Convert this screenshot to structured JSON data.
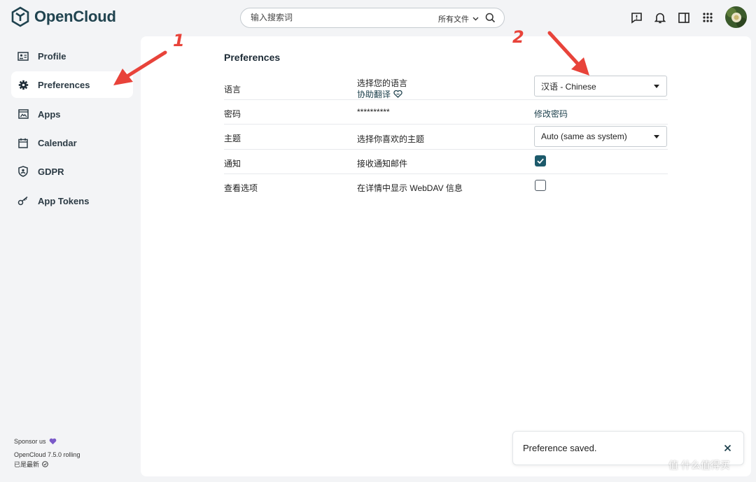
{
  "header": {
    "app_name": "OpenCloud",
    "search": {
      "placeholder": "输入搜索词",
      "scope": "所有文件"
    }
  },
  "sidebar": {
    "items": [
      {
        "label": "Profile",
        "icon": "profile-card-icon",
        "active": false
      },
      {
        "label": "Preferences",
        "icon": "gear-icon",
        "active": true
      },
      {
        "label": "Apps",
        "icon": "apps-window-icon",
        "active": false
      },
      {
        "label": "Calendar",
        "icon": "calendar-icon",
        "active": false
      },
      {
        "label": "GDPR",
        "icon": "shield-user-icon",
        "active": false
      },
      {
        "label": "App Tokens",
        "icon": "key-icon",
        "active": false
      }
    ],
    "sponsor": "Sponsor us",
    "version": "OpenCloud 7.5.0 rolling",
    "update_status": "已是最新"
  },
  "main": {
    "title": "Preferences",
    "rows": [
      {
        "label": "语言",
        "description": "选择您的语言",
        "sub_link": "协助翻译",
        "control": "select",
        "value": "汉语 - Chinese"
      },
      {
        "label": "密码",
        "description": "**********",
        "control": "link",
        "value": "修改密码"
      },
      {
        "label": "主题",
        "description": "选择你喜欢的主题",
        "control": "select",
        "value": "Auto (same as system)"
      },
      {
        "label": "通知",
        "description": "接收通知邮件",
        "control": "checkbox",
        "checked": true
      },
      {
        "label": "查看选项",
        "description": "在详情中显示 WebDAV 信息",
        "control": "checkbox",
        "checked": false
      }
    ]
  },
  "toast": {
    "message": "Preference saved."
  },
  "annotations": {
    "arrow1": "1",
    "arrow2": "2"
  },
  "watermark": "值 什么值得买",
  "colors": {
    "accent": "#1d5a6b",
    "brand": "#20434f",
    "annotation": "#e8433a",
    "sponsor_heart": "#7b5ac9"
  }
}
